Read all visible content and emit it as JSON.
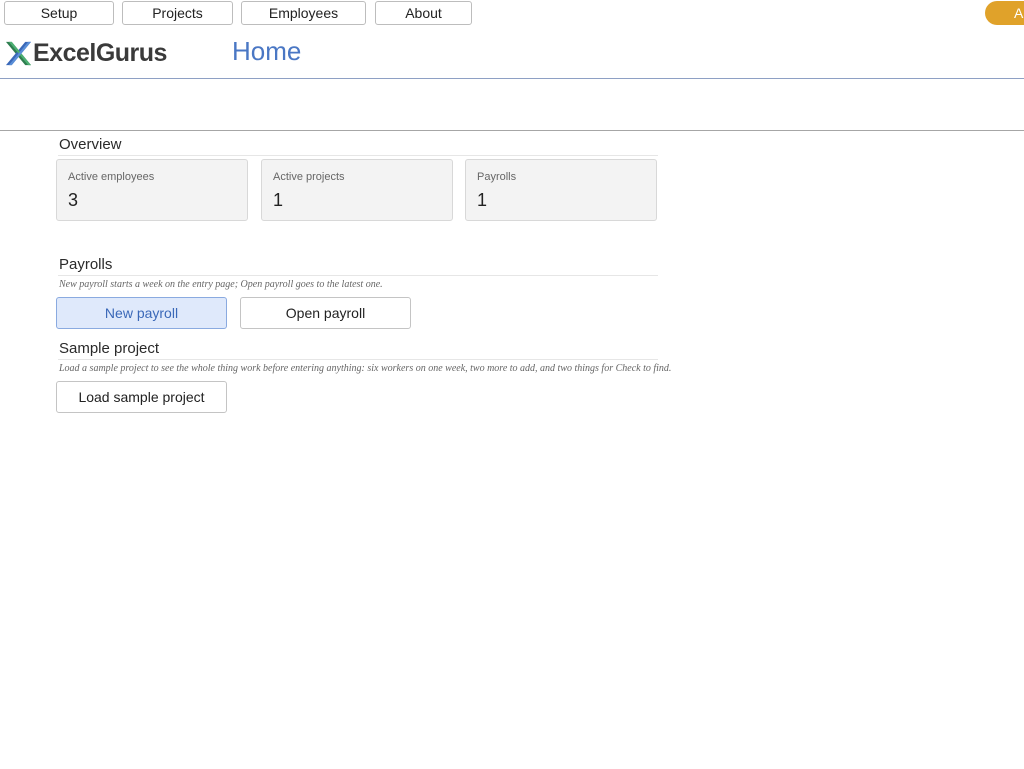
{
  "nav": {
    "setup": "Setup",
    "projects": "Projects",
    "employees": "Employees",
    "about": "About",
    "pill_label": "A"
  },
  "brand": {
    "name": "ExcelGurus",
    "icon": "excelgurus-x-logo-icon"
  },
  "header": {
    "title": "Home"
  },
  "overview": {
    "title": "Overview",
    "cards": [
      {
        "label": "Active employees",
        "value": "3"
      },
      {
        "label": "Active projects",
        "value": "1"
      },
      {
        "label": "Payrolls",
        "value": "1"
      }
    ]
  },
  "payrolls": {
    "title": "Payrolls",
    "hint": "New payroll starts a week on the entry page; Open payroll goes to the latest one.",
    "new_label": "New payroll",
    "open_label": "Open payroll"
  },
  "sample": {
    "title": "Sample project",
    "hint": "Load a sample project to see the whole thing work before entering anything: six workers on one week, two more to add, and two things for Check to find.",
    "load_label": "Load sample project"
  },
  "colors": {
    "accent": "#4a77c4",
    "pill": "#e0a22a",
    "primary_button_bg": "#dfe9fb"
  }
}
